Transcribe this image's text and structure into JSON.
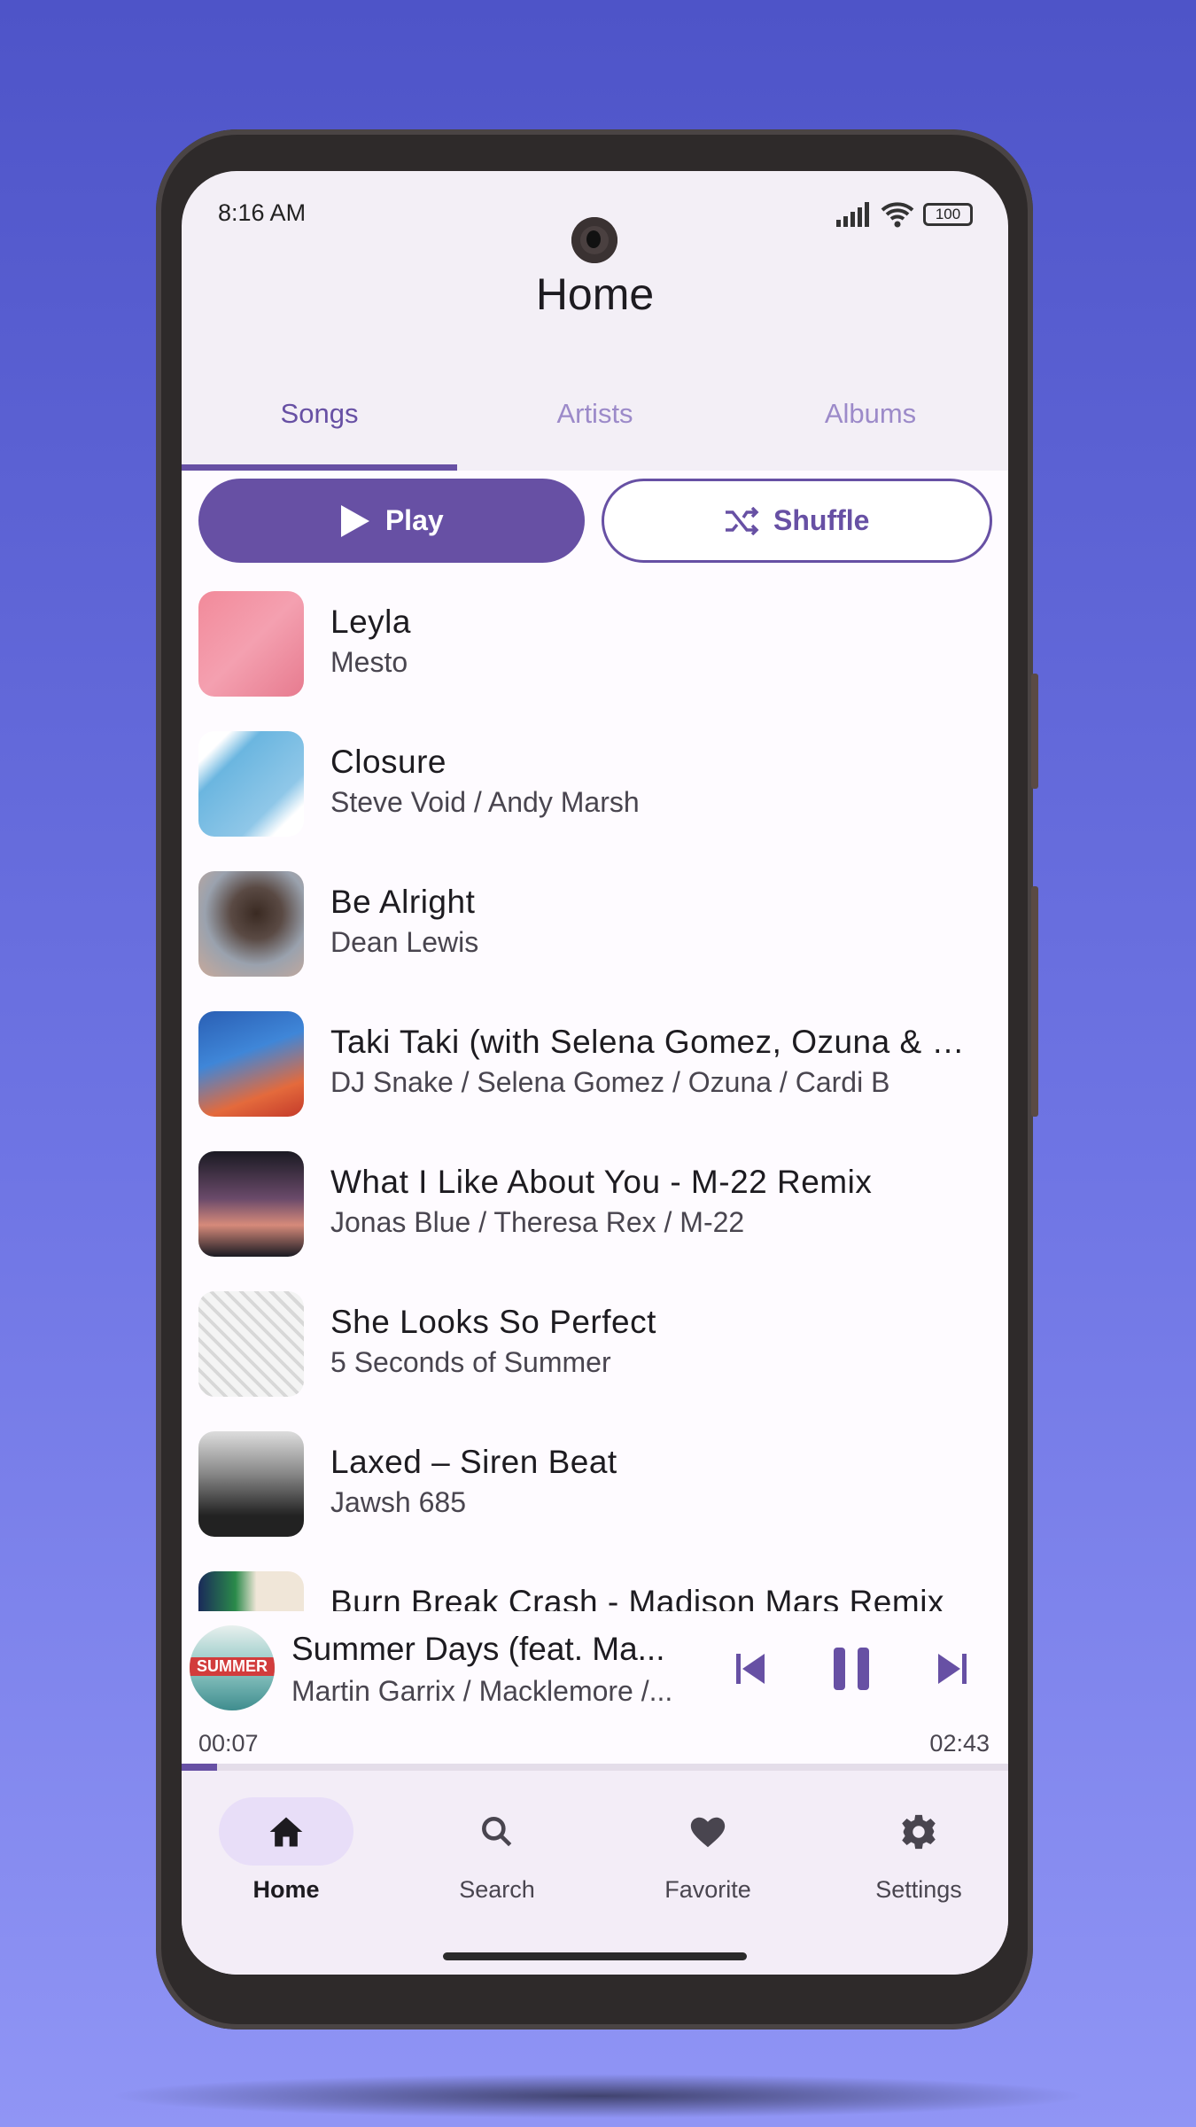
{
  "status_bar": {
    "time": "8:16 AM",
    "battery": "100"
  },
  "header": {
    "title": "Home"
  },
  "tabs": [
    {
      "label": "Songs",
      "active": true
    },
    {
      "label": "Artists",
      "active": false
    },
    {
      "label": "Albums",
      "active": false
    }
  ],
  "actions": {
    "play": "Play",
    "shuffle": "Shuffle"
  },
  "songs": [
    {
      "title": "Leyla",
      "artist": "Mesto"
    },
    {
      "title": "Closure",
      "artist": "Steve Void / Andy Marsh"
    },
    {
      "title": "Be Alright",
      "artist": "Dean Lewis"
    },
    {
      "title": "Taki Taki (with Selena Gomez, Ozuna & Cardi B)",
      "artist": "DJ Snake / Selena Gomez / Ozuna / Cardi B"
    },
    {
      "title": "What I Like About You - M-22 Remix",
      "artist": "Jonas Blue / Theresa Rex / M-22"
    },
    {
      "title": "She Looks So Perfect",
      "artist": "5 Seconds of Summer"
    },
    {
      "title": "Laxed – Siren Beat",
      "artist": "Jawsh 685"
    },
    {
      "title": "Burn Break Crash - Madison Mars Remix",
      "artist": ""
    }
  ],
  "now_playing": {
    "title": "Summer Days (feat. Ma...",
    "artist": "Martin Garrix / Macklemore /...",
    "art_text": "SUMMER",
    "elapsed": "00:07",
    "duration": "02:43",
    "progress": 0.043
  },
  "nav": [
    {
      "label": "Home",
      "icon": "home-icon",
      "active": true
    },
    {
      "label": "Search",
      "icon": "search-icon"
    },
    {
      "label": "Favorite",
      "icon": "heart-icon"
    },
    {
      "label": "Settings",
      "icon": "gear-icon"
    }
  ],
  "colors": {
    "primary": "#6750a4",
    "surface": "#fefbff",
    "nav_bg": "#f3edf7"
  }
}
